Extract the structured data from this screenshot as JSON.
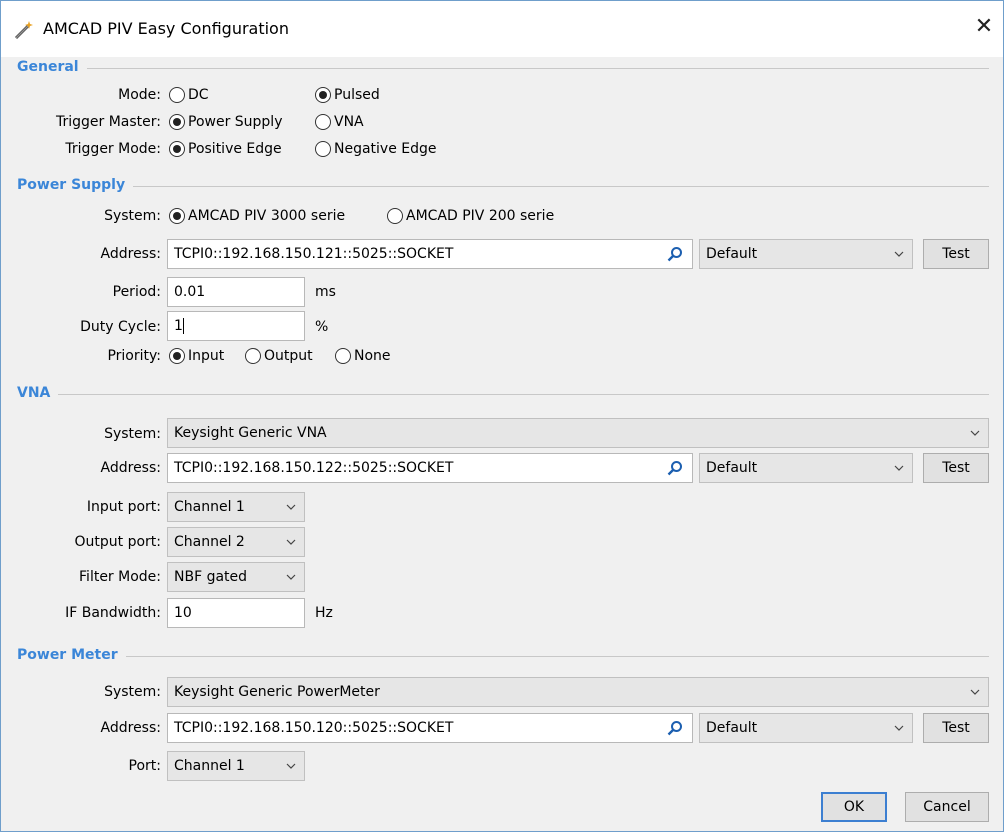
{
  "window": {
    "title": "AMCAD PIV Easy Configuration",
    "close_glyph": "✕",
    "app_icon": "wand-icon"
  },
  "general": {
    "title": "General",
    "mode_label": "Mode:",
    "mode_options": [
      "DC",
      "Pulsed"
    ],
    "mode_selected": "Pulsed",
    "trigger_master_label": "Trigger Master:",
    "trigger_master_options": [
      "Power Supply",
      "VNA"
    ],
    "trigger_master_selected": "Power Supply",
    "trigger_mode_label": "Trigger Mode:",
    "trigger_mode_options": [
      "Positive Edge",
      "Negative Edge"
    ],
    "trigger_mode_selected": "Positive Edge"
  },
  "power_supply": {
    "title": "Power Supply",
    "system_label": "System:",
    "system_options": [
      "AMCAD PIV 3000 serie",
      "AMCAD PIV 200 serie"
    ],
    "system_selected": "AMCAD PIV 3000 serie",
    "address_label": "Address:",
    "address_value": "TCPI0::192.168.150.121::5025::SOCKET",
    "address_profile": "Default",
    "test_label": "Test",
    "period_label": "Period:",
    "period_value": "0.01",
    "period_unit": "ms",
    "duty_label": "Duty Cycle:",
    "duty_value": "1",
    "duty_unit": "%",
    "priority_label": "Priority:",
    "priority_options": [
      "Input",
      "Output",
      "None"
    ],
    "priority_selected": "Input"
  },
  "vna": {
    "title": "VNA",
    "system_label": "System:",
    "system_value": "Keysight Generic VNA",
    "address_label": "Address:",
    "address_value": "TCPI0::192.168.150.122::5025::SOCKET",
    "address_profile": "Default",
    "test_label": "Test",
    "input_port_label": "Input port:",
    "input_port_value": "Channel 1",
    "output_port_label": "Output port:",
    "output_port_value": "Channel 2",
    "filter_mode_label": "Filter Mode:",
    "filter_mode_value": "NBF gated",
    "if_bandwidth_label": "IF Bandwidth:",
    "if_bandwidth_value": "10",
    "if_bandwidth_unit": "Hz"
  },
  "power_meter": {
    "title": "Power Meter",
    "system_label": "System:",
    "system_value": "Keysight Generic PowerMeter",
    "address_label": "Address:",
    "address_value": "TCPI0::192.168.150.120::5025::SOCKET",
    "address_profile": "Default",
    "test_label": "Test",
    "port_label": "Port:",
    "port_value": "Channel 1"
  },
  "footer": {
    "ok_label": "OK",
    "cancel_label": "Cancel"
  },
  "colors": {
    "section_title": "#3b86d8",
    "window_border": "#6f9ecb",
    "default_button_border": "#3c7fd1"
  }
}
